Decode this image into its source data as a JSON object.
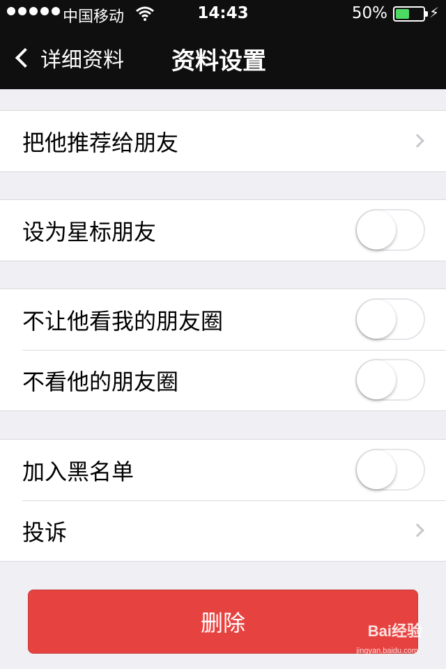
{
  "status_bar": {
    "carrier": "中国移动",
    "time": "14:43",
    "battery": "50%",
    "battery_level": 0.5,
    "battery_color": "#4cd964"
  },
  "nav": {
    "back_label": "详细资料",
    "title": "资料设置"
  },
  "groups": [
    {
      "rows": [
        {
          "label": "把他推荐给朋友",
          "control": "chevron"
        }
      ]
    },
    {
      "rows": [
        {
          "label": "设为星标朋友",
          "control": "switch",
          "on": false
        }
      ]
    },
    {
      "rows": [
        {
          "label": "不让他看我的朋友圈",
          "control": "switch",
          "on": false
        },
        {
          "label": "不看他的朋友圈",
          "control": "switch",
          "on": false
        }
      ]
    },
    {
      "rows": [
        {
          "label": "加入黑名单",
          "control": "switch",
          "on": false
        },
        {
          "label": "投诉",
          "control": "chevron"
        }
      ]
    }
  ],
  "delete_button": {
    "label": "删除",
    "color": "#e64340"
  },
  "watermark": {
    "text": "Bai经验",
    "sub": "jingyan.baidu.com"
  },
  "icons": {
    "back": "chevron-left-icon",
    "row_disclosure": "chevron-right-icon",
    "wifi": "wifi-icon",
    "battery": "battery-icon",
    "charging": "bolt-icon"
  }
}
